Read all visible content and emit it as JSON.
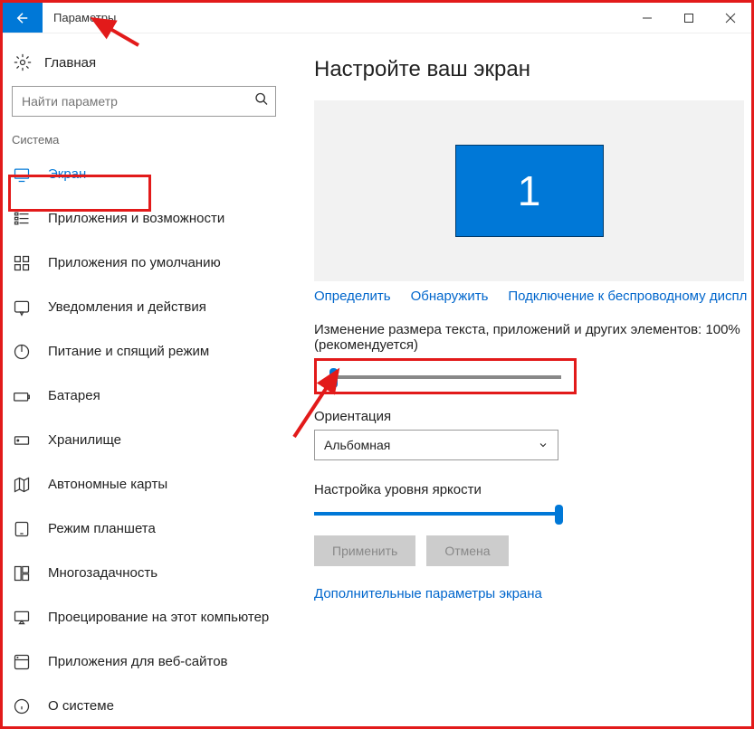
{
  "titlebar": {
    "title": "Параметры"
  },
  "sidebar": {
    "home_label": "Главная",
    "search_placeholder": "Найти параметр",
    "section_label": "Система",
    "items": [
      {
        "label": "Экран",
        "icon": "display-icon",
        "active": true
      },
      {
        "label": "Приложения и возможности",
        "icon": "apps-icon"
      },
      {
        "label": "Приложения по умолчанию",
        "icon": "defaults-icon"
      },
      {
        "label": "Уведомления и действия",
        "icon": "notifications-icon"
      },
      {
        "label": "Питание и спящий режим",
        "icon": "power-icon"
      },
      {
        "label": "Батарея",
        "icon": "battery-icon"
      },
      {
        "label": "Хранилище",
        "icon": "storage-icon"
      },
      {
        "label": "Автономные карты",
        "icon": "maps-icon"
      },
      {
        "label": "Режим планшета",
        "icon": "tablet-icon"
      },
      {
        "label": "Многозадачность",
        "icon": "multitask-icon"
      },
      {
        "label": "Проецирование на этот компьютер",
        "icon": "project-icon"
      },
      {
        "label": "Приложения для веб-сайтов",
        "icon": "webapps-icon"
      },
      {
        "label": "О системе",
        "icon": "about-icon"
      }
    ]
  },
  "main": {
    "title": "Настройте ваш экран",
    "monitor_number": "1",
    "detect_link": "Определить",
    "discover_link": "Обнаружить",
    "wireless_link": "Подключение к беспроводному диспл",
    "scale_label": "Изменение размера текста, приложений и других элементов: 100% (рекомендуется)",
    "orientation_label": "Ориентация",
    "orientation_value": "Альбомная",
    "brightness_label": "Настройка уровня яркости",
    "apply_btn": "Применить",
    "cancel_btn": "Отмена",
    "advanced_link": "Дополнительные параметры экрана"
  }
}
